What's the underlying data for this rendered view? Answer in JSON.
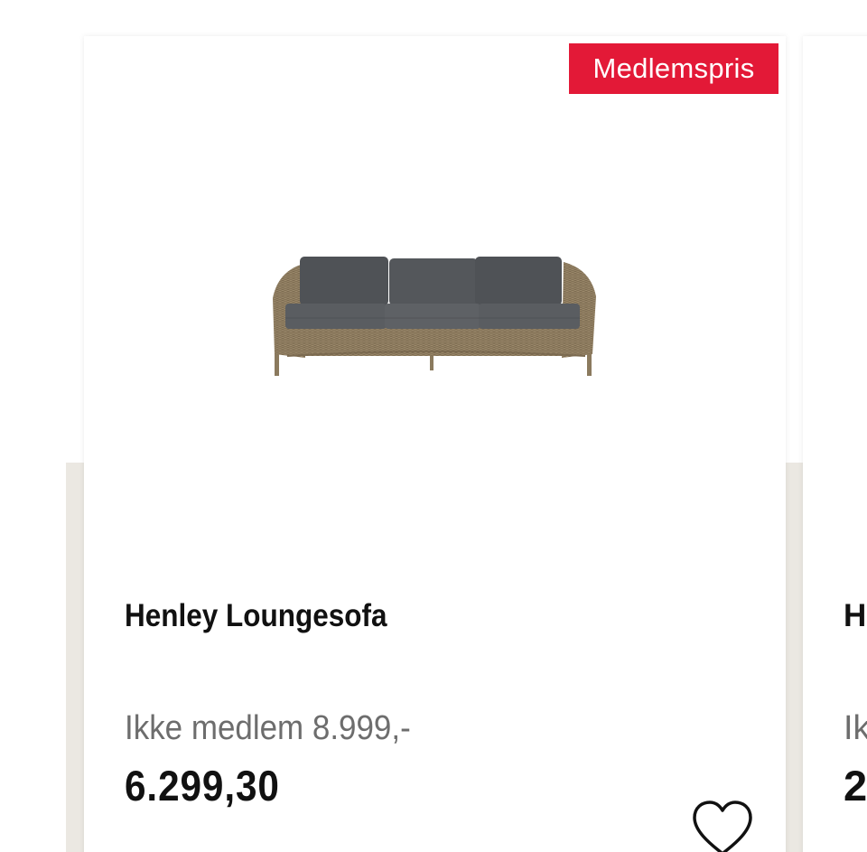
{
  "background_band_color": "#ebe8e2",
  "badge_color": "#e31937",
  "product_card": {
    "badge": "Medlemspris",
    "image_icon": "lounge-sofa-image",
    "title": "Henley Loungesofa",
    "regular_price": "Ikke medlem 8.999,-",
    "member_price": "6.299,30",
    "wishlist_icon": "heart-outline-icon"
  },
  "next_card": {
    "title_partial": "H",
    "regular_price_partial": "Ik",
    "member_price_partial": "2"
  }
}
